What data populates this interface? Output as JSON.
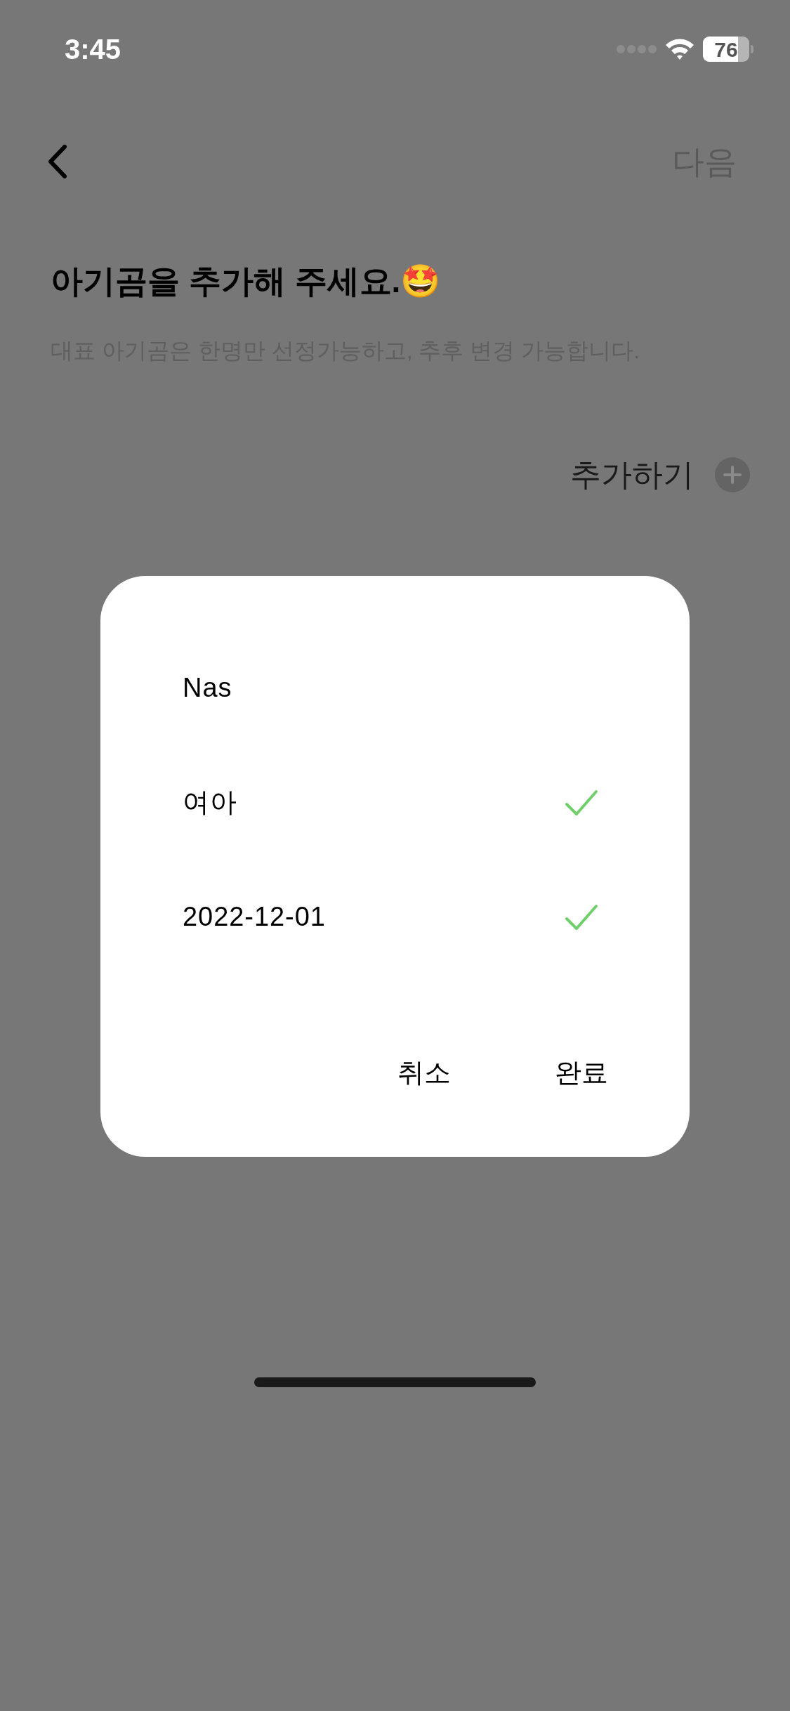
{
  "status_bar": {
    "time": "3:45",
    "battery": "76"
  },
  "header": {
    "next_button": "다음"
  },
  "title": "아기곰을 추가해 주세요.🤩",
  "subtitle": "대표 아기곰은 한명만 선정가능하고, 추후 변경 가능합니다.",
  "add_button": "추가하기",
  "dialog": {
    "rows": [
      {
        "label": "Nas",
        "checked": false
      },
      {
        "label": "여아",
        "checked": true
      },
      {
        "label": "2022-12-01",
        "checked": true
      }
    ],
    "buttons": [
      "취소",
      "완료"
    ]
  }
}
